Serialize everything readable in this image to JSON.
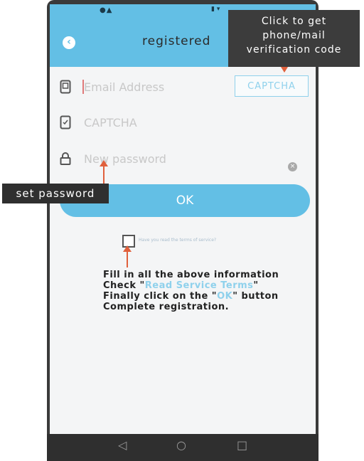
{
  "app": {
    "title": "registered",
    "back_icon": "chevron-left-icon",
    "accent_color": "#63bfe5",
    "status_left": "●▲",
    "status_right": "▮ ▾"
  },
  "form": {
    "email_placeholder": "Email Address",
    "captcha_placeholder": "CAPTCHA",
    "password_placeholder": "New password",
    "captcha_button": "CAPTCHA",
    "ok_button": "OK",
    "terms_text": "Have you read the terms of service?",
    "clear_icon": "×"
  },
  "annotations": {
    "callout_line1": "Click to get",
    "callout_line2": "phone/mail",
    "callout_line3": "verification code",
    "set_password": "set password",
    "instr_line1": "Fill in all the above information",
    "instr_check_prefix": "Check \"",
    "instr_check_link": "Read Service Terms",
    "instr_check_suffix": "\"",
    "instr_final_prefix": "Finally click on the \"",
    "instr_final_ok": "OK",
    "instr_final_suffix": "\" button",
    "instr_line4": "Complete registration."
  },
  "navbar": {
    "back": "◁",
    "home": "○",
    "recent": "□"
  }
}
